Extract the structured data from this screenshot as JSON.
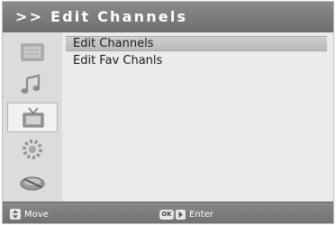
{
  "header": {
    "title": ">> Edit Channels"
  },
  "sidebar": {
    "items": [
      {
        "name": "picture-icon",
        "selected": false
      },
      {
        "name": "music-note-icon",
        "selected": false
      },
      {
        "name": "tv-icon",
        "selected": true
      },
      {
        "name": "settings-icon",
        "selected": false
      },
      {
        "name": "satellite-dish-icon",
        "selected": false
      }
    ]
  },
  "menu": {
    "items": [
      {
        "label": "Edit Channels",
        "selected": true
      },
      {
        "label": "Edit Fav Chanls",
        "selected": false
      }
    ]
  },
  "footer": {
    "move": {
      "label": "Move",
      "icon": "up-down-arrow-icon"
    },
    "enter": {
      "label": "Enter",
      "key": "OK",
      "icon": "right-arrow-icon"
    }
  },
  "colors": {
    "title_bar": "#7d7d7d",
    "panel": "#ebebeb",
    "selected_item": "#c4c4c4",
    "text": "#1a1a1a"
  }
}
